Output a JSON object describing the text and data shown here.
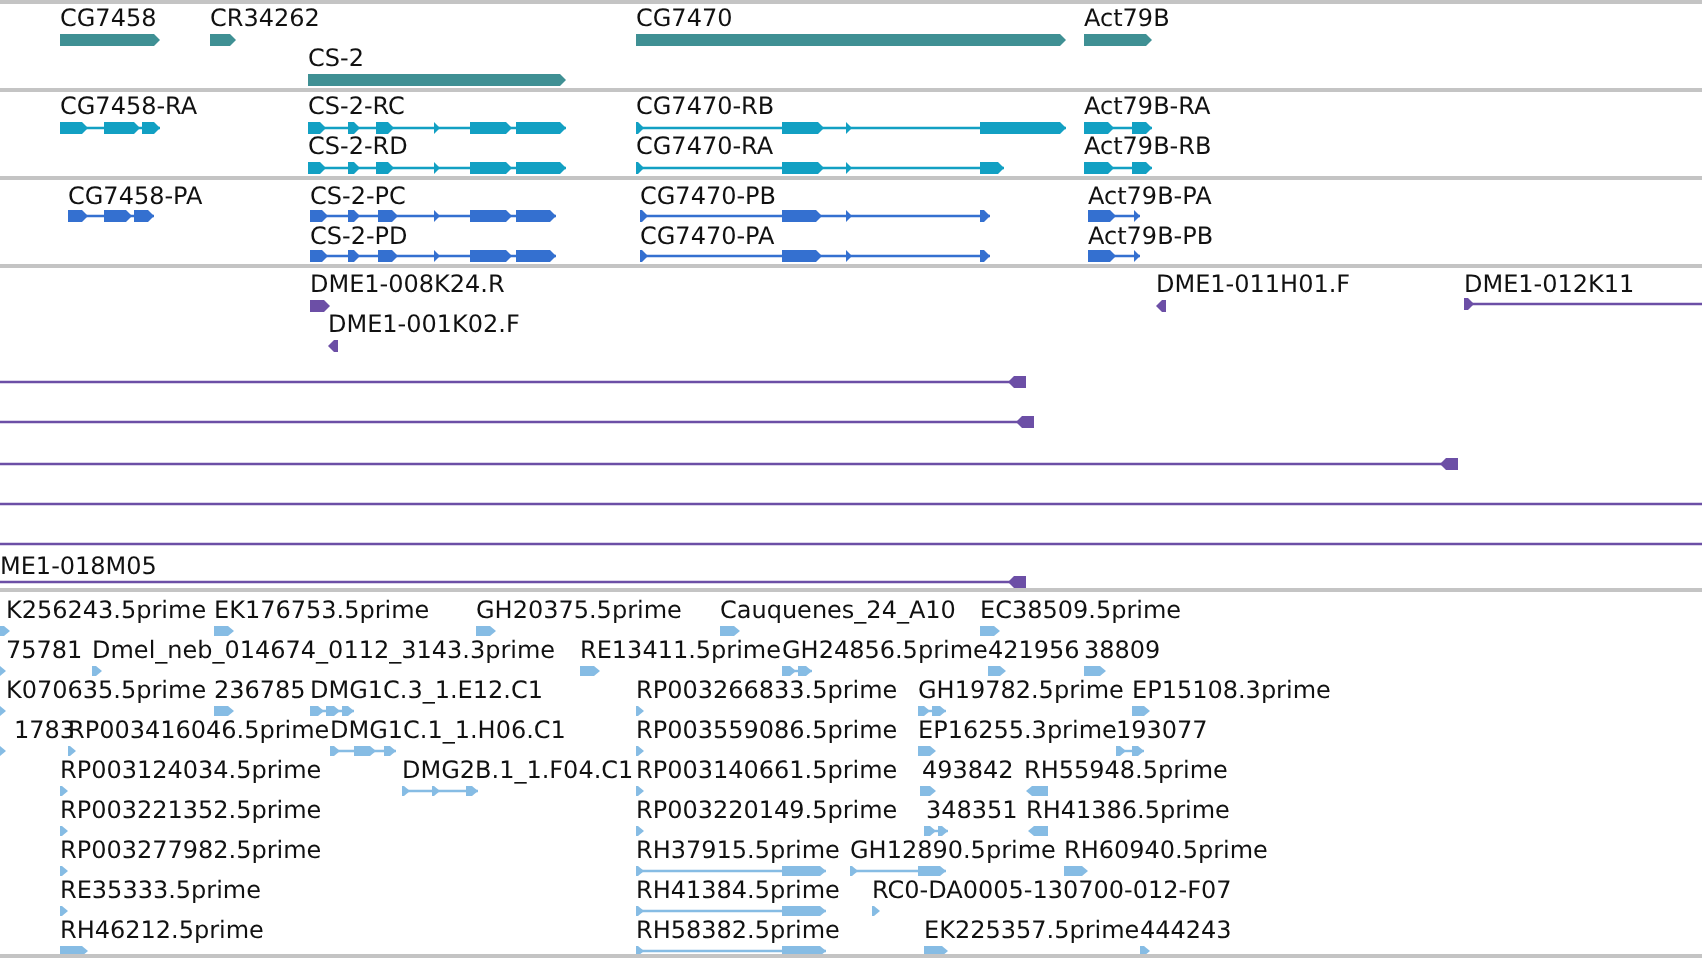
{
  "tracks": [
    {
      "kind": "gene",
      "features": [
        {
          "label": "CG7458"
        },
        {
          "label": "CR34262"
        },
        {
          "label": "CS-2"
        },
        {
          "label": "CG7470"
        },
        {
          "label": "Act79B"
        }
      ]
    },
    {
      "kind": "mrna",
      "features": [
        {
          "label": "CG7458-RA"
        },
        {
          "label": "CS-2-RC"
        },
        {
          "label": "CS-2-RD"
        },
        {
          "label": "CG7470-RB"
        },
        {
          "label": "CG7470-RA"
        },
        {
          "label": "Act79B-RA"
        },
        {
          "label": "Act79B-RB"
        }
      ]
    },
    {
      "kind": "protein",
      "features": [
        {
          "label": "CG7458-PA"
        },
        {
          "label": "CS-2-PC"
        },
        {
          "label": "CS-2-PD"
        },
        {
          "label": "CG7470-PB"
        },
        {
          "label": "CG7470-PA"
        },
        {
          "label": "Act79B-PA"
        },
        {
          "label": "Act79B-PB"
        }
      ]
    },
    {
      "kind": "clone",
      "features": [
        {
          "label": "DME1-008K24.R",
          "kind": "end",
          "reverse": false
        },
        {
          "label": "DME1-001K02.F",
          "kind": "end",
          "reverse": true
        },
        {
          "label": "DME1-011H01.F",
          "kind": "end",
          "reverse": true
        },
        {
          "label": "DME1-012K11",
          "kind": "span",
          "reverse": false
        },
        {
          "kind": "span",
          "reverse": true
        },
        {
          "kind": "span",
          "reverse": true
        },
        {
          "kind": "span",
          "reverse": true
        },
        {
          "kind": "span"
        },
        {
          "kind": "span"
        },
        {
          "label": "ME1-018M05",
          "kind": "span",
          "reverse": true
        }
      ]
    },
    {
      "kind": "est",
      "features": [
        {
          "label": "K256243.5prime",
          "reverse": false
        },
        {
          "label": "EK176753.5prime",
          "reverse": false
        },
        {
          "label": "GH20375.5prime",
          "reverse": false
        },
        {
          "label": "Cauquenes_24_A10",
          "reverse": false
        },
        {
          "label": "EC38509.5prime",
          "reverse": false
        },
        {
          "label": "75781",
          "reverse": false
        },
        {
          "label": "Dmel_neb_014674_0112_3143.3prime",
          "reverse": false
        },
        {
          "label": "RE13411.5prime",
          "reverse": false
        },
        {
          "label": "GH24856.5prime",
          "reverse": false
        },
        {
          "label": "421956",
          "reverse": false
        },
        {
          "label": "38809",
          "reverse": false
        },
        {
          "label": "K070635.5prime",
          "reverse": false
        },
        {
          "label": "236785",
          "reverse": false
        },
        {
          "label": "DMG1C.3_1.E12.C1",
          "reverse": false
        },
        {
          "label": "RP003266833.5prime",
          "reverse": false
        },
        {
          "label": "GH19782.5prime",
          "reverse": false
        },
        {
          "label": "EP15108.3prime",
          "reverse": false
        },
        {
          "label": "1783",
          "reverse": false
        },
        {
          "label": "RP003416046.5prime",
          "reverse": false
        },
        {
          "label": "DMG1C.1_1.H06.C1",
          "reverse": false
        },
        {
          "label": "RP003559086.5prime",
          "reverse": false
        },
        {
          "label": "EP16255.3prime",
          "reverse": false
        },
        {
          "label": "193077",
          "reverse": false
        },
        {
          "label": "RP003124034.5prime",
          "reverse": false
        },
        {
          "label": "DMG2B.1_1.F04.C1",
          "reverse": false
        },
        {
          "label": "RP003140661.5prime",
          "reverse": false
        },
        {
          "label": "493842",
          "reverse": false
        },
        {
          "label": "RH55948.5prime",
          "reverse": true
        },
        {
          "label": "RP003221352.5prime",
          "reverse": false
        },
        {
          "label": "RP003220149.5prime",
          "reverse": false
        },
        {
          "label": "348351",
          "reverse": false
        },
        {
          "label": "RH41386.5prime",
          "reverse": true
        },
        {
          "label": "RP003277982.5prime",
          "reverse": false
        },
        {
          "label": "RH37915.5prime",
          "reverse": false
        },
        {
          "label": "GH12890.5prime",
          "reverse": false
        },
        {
          "label": "RH60940.5prime",
          "reverse": false
        },
        {
          "label": "RE35333.5prime",
          "reverse": false
        },
        {
          "label": "RH41384.5prime",
          "reverse": false
        },
        {
          "label": "RC0-DA0005-130700-012-F07",
          "reverse": false
        },
        {
          "label": "RH46212.5prime",
          "reverse": false
        },
        {
          "label": "RH58382.5prime",
          "reverse": false
        },
        {
          "label": "EK225357.5prime",
          "reverse": false
        },
        {
          "label": "444243",
          "reverse": false
        }
      ]
    }
  ]
}
